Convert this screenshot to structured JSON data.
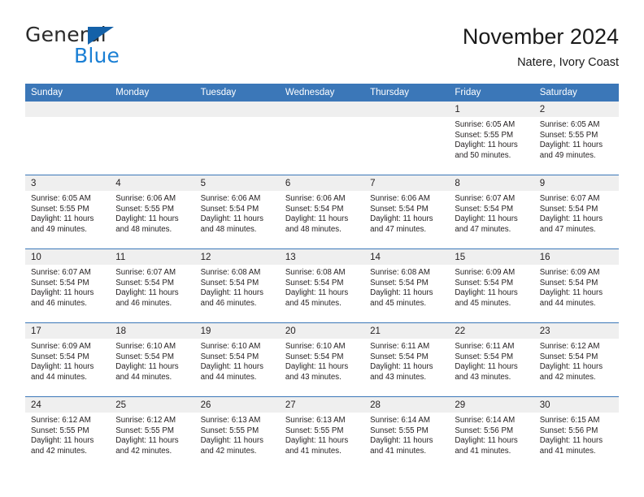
{
  "brand": {
    "name_part1": "General",
    "name_part2": "Blue",
    "logo_icon": "blue-triangle"
  },
  "header": {
    "title": "November 2024",
    "subtitle": "Natere, Ivory Coast"
  },
  "colors": {
    "header_blue": "#3B77B8",
    "daynum_band": "#EFEFEF",
    "logo_blue": "#1A7FD4",
    "logo_triangle": "#1461A8",
    "text": "#231F20"
  },
  "weekdays": [
    "Sunday",
    "Monday",
    "Tuesday",
    "Wednesday",
    "Thursday",
    "Friday",
    "Saturday"
  ],
  "weeks": [
    [
      {
        "day": "",
        "lines": []
      },
      {
        "day": "",
        "lines": []
      },
      {
        "day": "",
        "lines": []
      },
      {
        "day": "",
        "lines": []
      },
      {
        "day": "",
        "lines": []
      },
      {
        "day": "1",
        "lines": [
          "Sunrise: 6:05 AM",
          "Sunset: 5:55 PM",
          "Daylight: 11 hours",
          "and 50 minutes."
        ]
      },
      {
        "day": "2",
        "lines": [
          "Sunrise: 6:05 AM",
          "Sunset: 5:55 PM",
          "Daylight: 11 hours",
          "and 49 minutes."
        ]
      }
    ],
    [
      {
        "day": "3",
        "lines": [
          "Sunrise: 6:05 AM",
          "Sunset: 5:55 PM",
          "Daylight: 11 hours",
          "and 49 minutes."
        ]
      },
      {
        "day": "4",
        "lines": [
          "Sunrise: 6:06 AM",
          "Sunset: 5:55 PM",
          "Daylight: 11 hours",
          "and 48 minutes."
        ]
      },
      {
        "day": "5",
        "lines": [
          "Sunrise: 6:06 AM",
          "Sunset: 5:54 PM",
          "Daylight: 11 hours",
          "and 48 minutes."
        ]
      },
      {
        "day": "6",
        "lines": [
          "Sunrise: 6:06 AM",
          "Sunset: 5:54 PM",
          "Daylight: 11 hours",
          "and 48 minutes."
        ]
      },
      {
        "day": "7",
        "lines": [
          "Sunrise: 6:06 AM",
          "Sunset: 5:54 PM",
          "Daylight: 11 hours",
          "and 47 minutes."
        ]
      },
      {
        "day": "8",
        "lines": [
          "Sunrise: 6:07 AM",
          "Sunset: 5:54 PM",
          "Daylight: 11 hours",
          "and 47 minutes."
        ]
      },
      {
        "day": "9",
        "lines": [
          "Sunrise: 6:07 AM",
          "Sunset: 5:54 PM",
          "Daylight: 11 hours",
          "and 47 minutes."
        ]
      }
    ],
    [
      {
        "day": "10",
        "lines": [
          "Sunrise: 6:07 AM",
          "Sunset: 5:54 PM",
          "Daylight: 11 hours",
          "and 46 minutes."
        ]
      },
      {
        "day": "11",
        "lines": [
          "Sunrise: 6:07 AM",
          "Sunset: 5:54 PM",
          "Daylight: 11 hours",
          "and 46 minutes."
        ]
      },
      {
        "day": "12",
        "lines": [
          "Sunrise: 6:08 AM",
          "Sunset: 5:54 PM",
          "Daylight: 11 hours",
          "and 46 minutes."
        ]
      },
      {
        "day": "13",
        "lines": [
          "Sunrise: 6:08 AM",
          "Sunset: 5:54 PM",
          "Daylight: 11 hours",
          "and 45 minutes."
        ]
      },
      {
        "day": "14",
        "lines": [
          "Sunrise: 6:08 AM",
          "Sunset: 5:54 PM",
          "Daylight: 11 hours",
          "and 45 minutes."
        ]
      },
      {
        "day": "15",
        "lines": [
          "Sunrise: 6:09 AM",
          "Sunset: 5:54 PM",
          "Daylight: 11 hours",
          "and 45 minutes."
        ]
      },
      {
        "day": "16",
        "lines": [
          "Sunrise: 6:09 AM",
          "Sunset: 5:54 PM",
          "Daylight: 11 hours",
          "and 44 minutes."
        ]
      }
    ],
    [
      {
        "day": "17",
        "lines": [
          "Sunrise: 6:09 AM",
          "Sunset: 5:54 PM",
          "Daylight: 11 hours",
          "and 44 minutes."
        ]
      },
      {
        "day": "18",
        "lines": [
          "Sunrise: 6:10 AM",
          "Sunset: 5:54 PM",
          "Daylight: 11 hours",
          "and 44 minutes."
        ]
      },
      {
        "day": "19",
        "lines": [
          "Sunrise: 6:10 AM",
          "Sunset: 5:54 PM",
          "Daylight: 11 hours",
          "and 44 minutes."
        ]
      },
      {
        "day": "20",
        "lines": [
          "Sunrise: 6:10 AM",
          "Sunset: 5:54 PM",
          "Daylight: 11 hours",
          "and 43 minutes."
        ]
      },
      {
        "day": "21",
        "lines": [
          "Sunrise: 6:11 AM",
          "Sunset: 5:54 PM",
          "Daylight: 11 hours",
          "and 43 minutes."
        ]
      },
      {
        "day": "22",
        "lines": [
          "Sunrise: 6:11 AM",
          "Sunset: 5:54 PM",
          "Daylight: 11 hours",
          "and 43 minutes."
        ]
      },
      {
        "day": "23",
        "lines": [
          "Sunrise: 6:12 AM",
          "Sunset: 5:54 PM",
          "Daylight: 11 hours",
          "and 42 minutes."
        ]
      }
    ],
    [
      {
        "day": "24",
        "lines": [
          "Sunrise: 6:12 AM",
          "Sunset: 5:55 PM",
          "Daylight: 11 hours",
          "and 42 minutes."
        ]
      },
      {
        "day": "25",
        "lines": [
          "Sunrise: 6:12 AM",
          "Sunset: 5:55 PM",
          "Daylight: 11 hours",
          "and 42 minutes."
        ]
      },
      {
        "day": "26",
        "lines": [
          "Sunrise: 6:13 AM",
          "Sunset: 5:55 PM",
          "Daylight: 11 hours",
          "and 42 minutes."
        ]
      },
      {
        "day": "27",
        "lines": [
          "Sunrise: 6:13 AM",
          "Sunset: 5:55 PM",
          "Daylight: 11 hours",
          "and 41 minutes."
        ]
      },
      {
        "day": "28",
        "lines": [
          "Sunrise: 6:14 AM",
          "Sunset: 5:55 PM",
          "Daylight: 11 hours",
          "and 41 minutes."
        ]
      },
      {
        "day": "29",
        "lines": [
          "Sunrise: 6:14 AM",
          "Sunset: 5:56 PM",
          "Daylight: 11 hours",
          "and 41 minutes."
        ]
      },
      {
        "day": "30",
        "lines": [
          "Sunrise: 6:15 AM",
          "Sunset: 5:56 PM",
          "Daylight: 11 hours",
          "and 41 minutes."
        ]
      }
    ]
  ]
}
